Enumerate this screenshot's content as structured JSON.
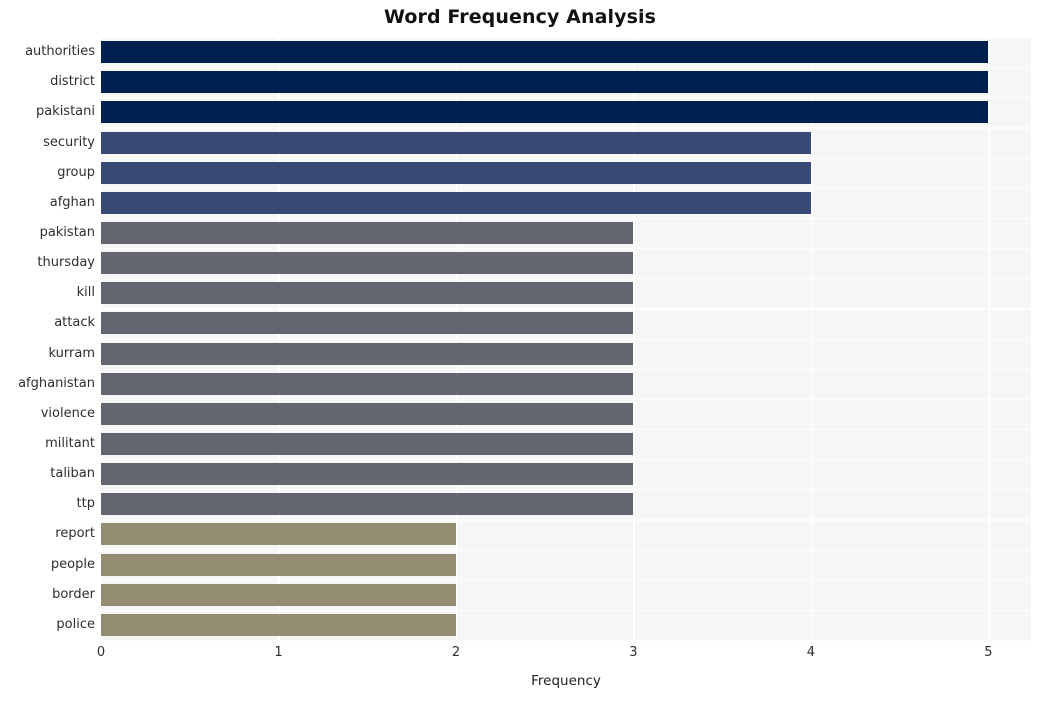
{
  "chart_data": {
    "type": "bar",
    "orientation": "horizontal",
    "title": "Word Frequency Analysis",
    "xlabel": "Frequency",
    "ylabel": "",
    "categories": [
      "authorities",
      "district",
      "pakistani",
      "security",
      "group",
      "afghan",
      "pakistan",
      "thursday",
      "kill",
      "attack",
      "kurram",
      "afghanistan",
      "violence",
      "militant",
      "taliban",
      "ttp",
      "report",
      "people",
      "border",
      "police"
    ],
    "values": [
      5,
      5,
      5,
      4,
      4,
      4,
      3,
      3,
      3,
      3,
      3,
      3,
      3,
      3,
      3,
      3,
      2,
      2,
      2,
      2
    ],
    "bar_colors": [
      "#002050",
      "#002050",
      "#002050",
      "#384a73",
      "#384a73",
      "#384a73",
      "#63666e",
      "#63666e",
      "#63666e",
      "#63666e",
      "#63666e",
      "#63666e",
      "#63666e",
      "#63666e",
      "#63666e",
      "#63666e",
      "#938d74",
      "#938d74",
      "#938d74",
      "#938d74"
    ],
    "xlim": [
      0,
      5.24
    ],
    "xticks": [
      0,
      1,
      2,
      3,
      4,
      5
    ],
    "xticklabels": [
      "0",
      "1",
      "2",
      "3",
      "4",
      "5"
    ],
    "grid": true,
    "grid_color": "#ffffff",
    "legend": null,
    "plot_background": "#f6f6f7",
    "figure_background": "#ffffff"
  }
}
